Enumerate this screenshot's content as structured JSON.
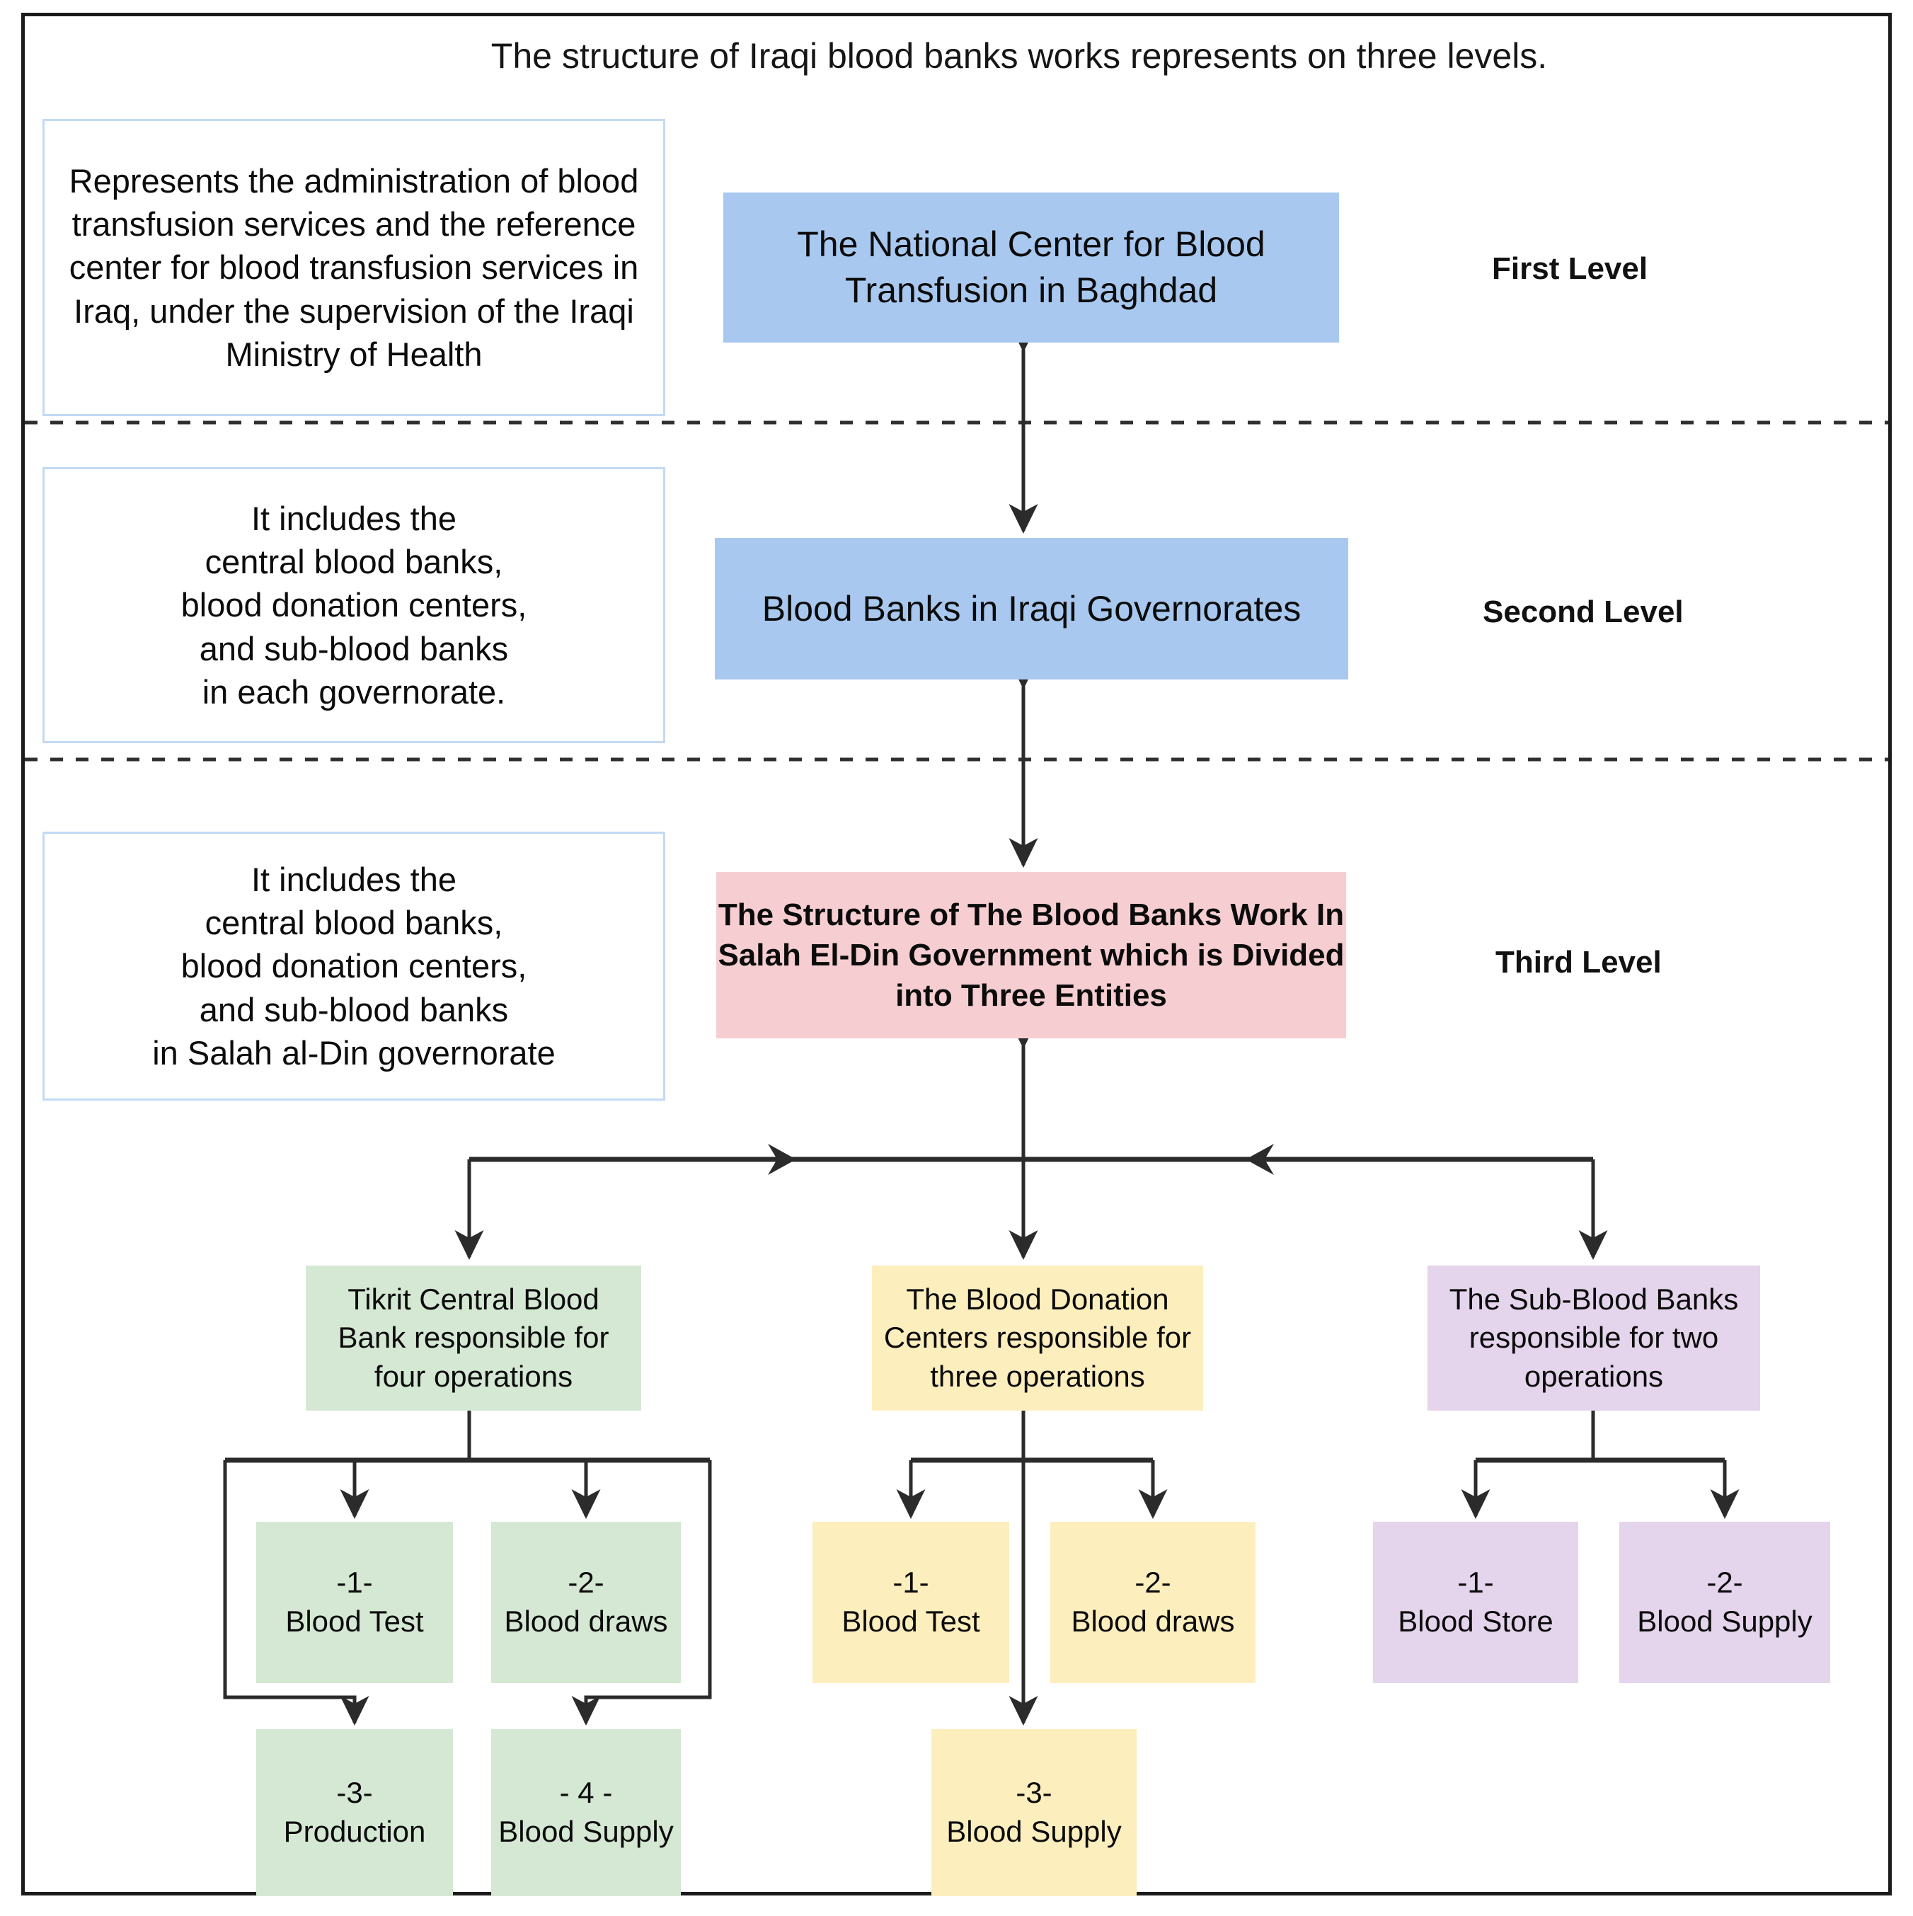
{
  "diagram": {
    "title": "The structure of Iraqi blood banks works represents on three levels.",
    "callouts": {
      "first": "Represents the administration of blood transfusion services and the reference center for blood transfusion services in Iraq, under the supervision of the Iraqi Ministry of Health",
      "second": "It includes the\ncentral blood banks,\nblood donation centers,\nand sub-blood banks\nin each governorate.",
      "third": "It includes the\ncentral blood banks,\nblood donation centers,\nand sub-blood banks\nin Salah al-Din governorate"
    },
    "level_labels": {
      "first": "First Level",
      "second": "Second Level",
      "third": "Third Level"
    },
    "nodes": {
      "national_center": "The National Center for Blood Transfusion in Baghdad",
      "governorate_banks": "Blood Banks in Iraqi Governorates",
      "salah_structure": "The Structure of The Blood Banks Work In Salah El-Din Government which is Divided into Three Entities"
    },
    "entities": [
      {
        "id": "tikrit",
        "label": "Tikrit Central Blood Bank responsible for four operations",
        "color": "#d5e8d4"
      },
      {
        "id": "donation",
        "label": "The Blood Donation Centers responsible for three operations",
        "color": "#fdeebe"
      },
      {
        "id": "subbank",
        "label": "The Sub-Blood Banks responsible for two operations",
        "color": "#e4d4ec"
      }
    ],
    "operations": {
      "tikrit": [
        {
          "num": "-1-",
          "name": "Blood Test"
        },
        {
          "num": "-2-",
          "name": "Blood draws"
        },
        {
          "num": "-3-",
          "name": "Production"
        },
        {
          "num": "- 4 -",
          "name": "Blood Supply"
        }
      ],
      "donation": [
        {
          "num": "-1-",
          "name": "Blood Test"
        },
        {
          "num": "-2-",
          "name": "Blood draws"
        },
        {
          "num": "-3-",
          "name": "Blood Supply"
        }
      ],
      "subbank": [
        {
          "num": "-1-",
          "name": "Blood Store"
        },
        {
          "num": "-2-",
          "name": "Blood Supply"
        }
      ]
    },
    "colors": {
      "level_box_blue": "#a8c8ef",
      "level_box_pink": "#f6ced1",
      "green": "#d5e8d4",
      "yellow": "#fdeebe",
      "purple": "#e4d4ec",
      "callout_border": "#c3d9f5",
      "frame": "#1b1b1b",
      "connector": "#2b2b2b"
    }
  }
}
